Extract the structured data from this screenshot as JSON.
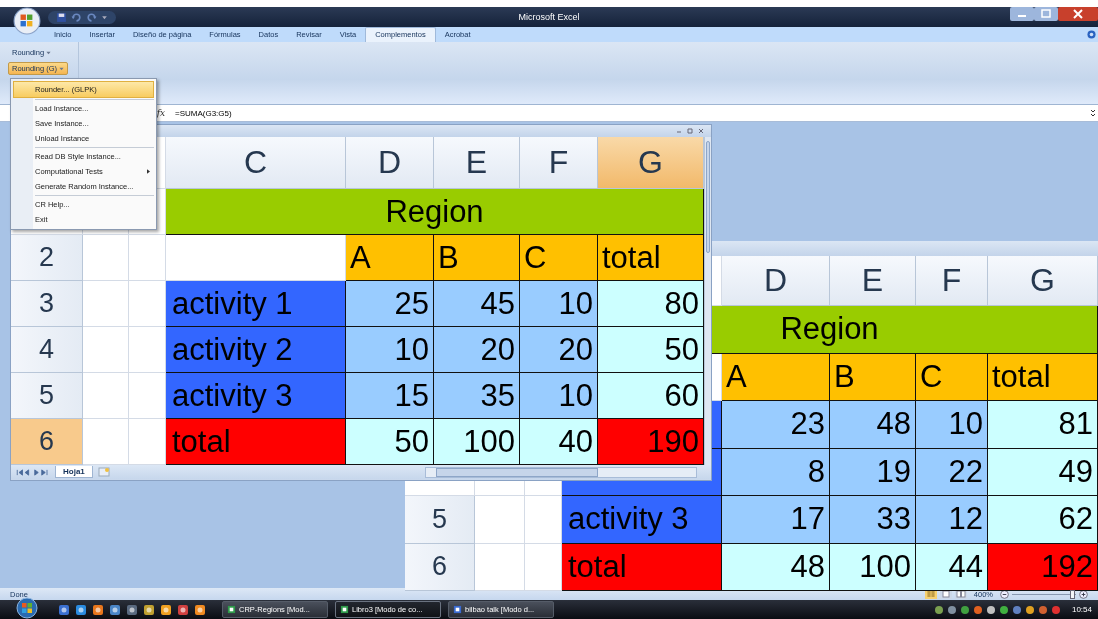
{
  "window": {
    "title": "Microsoft Excel"
  },
  "ribbon_tabs": [
    {
      "label": "Inicio",
      "selected": false
    },
    {
      "label": "Insertar",
      "selected": false
    },
    {
      "label": "Diseño de página",
      "selected": false
    },
    {
      "label": "Fórmulas",
      "selected": false
    },
    {
      "label": "Datos",
      "selected": false
    },
    {
      "label": "Revisar",
      "selected": false
    },
    {
      "label": "Vista",
      "selected": false
    },
    {
      "label": "Complementos",
      "selected": true
    },
    {
      "label": "Acrobat",
      "selected": false
    }
  ],
  "ribbon": {
    "buttons": [
      {
        "label": "Rounding",
        "pressed": false
      },
      {
        "label": "Rounding (G)",
        "pressed": true
      }
    ]
  },
  "menu": {
    "groups": [
      [
        {
          "label": "Rounder... (GLPK)",
          "selected": true,
          "submenu": false
        }
      ],
      [
        {
          "label": "Load Instance...",
          "selected": false,
          "submenu": false
        },
        {
          "label": "Save Instance...",
          "selected": false,
          "submenu": false
        },
        {
          "label": "Unload Instance",
          "selected": false,
          "submenu": false
        }
      ],
      [
        {
          "label": "Read DB Style Instance...",
          "selected": false,
          "submenu": false
        },
        {
          "label": "Computational Tests",
          "selected": false,
          "submenu": true
        },
        {
          "label": "Generate Random Instance...",
          "selected": false,
          "submenu": false
        }
      ],
      [
        {
          "label": "CR Help...",
          "selected": false,
          "submenu": false
        },
        {
          "label": "Exit",
          "selected": false,
          "submenu": false
        }
      ]
    ]
  },
  "formula_bar": {
    "function_label": "fx",
    "formula": "=SUMA(G3:G5)"
  },
  "front_sheet": {
    "columns": [
      {
        "label": "C",
        "selected": false
      },
      {
        "label": "D",
        "selected": false
      },
      {
        "label": "E",
        "selected": false
      },
      {
        "label": "F",
        "selected": false
      },
      {
        "label": "G",
        "selected": true
      }
    ],
    "rows": [
      {
        "kind": "title",
        "text": "Region"
      },
      {
        "kind": "header",
        "number": "2",
        "selected": false,
        "values": [
          "A",
          "B",
          "C",
          "total"
        ]
      },
      {
        "kind": "activity",
        "number": "3",
        "selected": false,
        "label": "activity 1",
        "values": [
          "25",
          "45",
          "10",
          "80"
        ]
      },
      {
        "kind": "activity",
        "number": "4",
        "selected": false,
        "label": "activity 2",
        "values": [
          "10",
          "20",
          "20",
          "50"
        ]
      },
      {
        "kind": "activity",
        "number": "5",
        "selected": false,
        "label": "activity 3",
        "values": [
          "15",
          "35",
          "10",
          "60"
        ]
      },
      {
        "kind": "total",
        "number": "6",
        "selected": true,
        "label": "total",
        "values": [
          "50",
          "100",
          "40",
          "190"
        ]
      }
    ],
    "sheet_tabs": [
      {
        "label": "Hoja1",
        "selected": true
      }
    ]
  },
  "back_sheet": {
    "columns": [
      {
        "label": "D",
        "selected": false
      },
      {
        "label": "E",
        "selected": false
      },
      {
        "label": "F",
        "selected": false
      },
      {
        "label": "G",
        "selected": false
      }
    ],
    "rows": [
      {
        "kind": "title",
        "text": "Region"
      },
      {
        "kind": "header",
        "values": [
          "A",
          "B",
          "C",
          "total"
        ]
      },
      {
        "kind": "activity",
        "values": [
          "23",
          "48",
          "10",
          "81"
        ]
      },
      {
        "kind": "activity",
        "values": [
          "8",
          "19",
          "22",
          "49"
        ]
      },
      {
        "kind": "activity",
        "number": "5",
        "selected": false,
        "label": "activity 3",
        "values": [
          "17",
          "33",
          "12",
          "62"
        ]
      },
      {
        "kind": "total",
        "number": "6",
        "selected": false,
        "label": "total",
        "values": [
          "48",
          "100",
          "44",
          "192"
        ]
      }
    ]
  },
  "status_bar": {
    "text": "Done",
    "zoom": "400%",
    "zoom_slider": {
      "level": 0.95
    }
  },
  "taskbar": {
    "tasks": [
      {
        "label": "CRP-Regions  [Mod...",
        "selected": false
      },
      {
        "label": "Libro3  [Modo de co...",
        "selected": true
      },
      {
        "label": "bilbao talk [Modo d...",
        "selected": false
      }
    ],
    "clock": "10:54"
  }
}
